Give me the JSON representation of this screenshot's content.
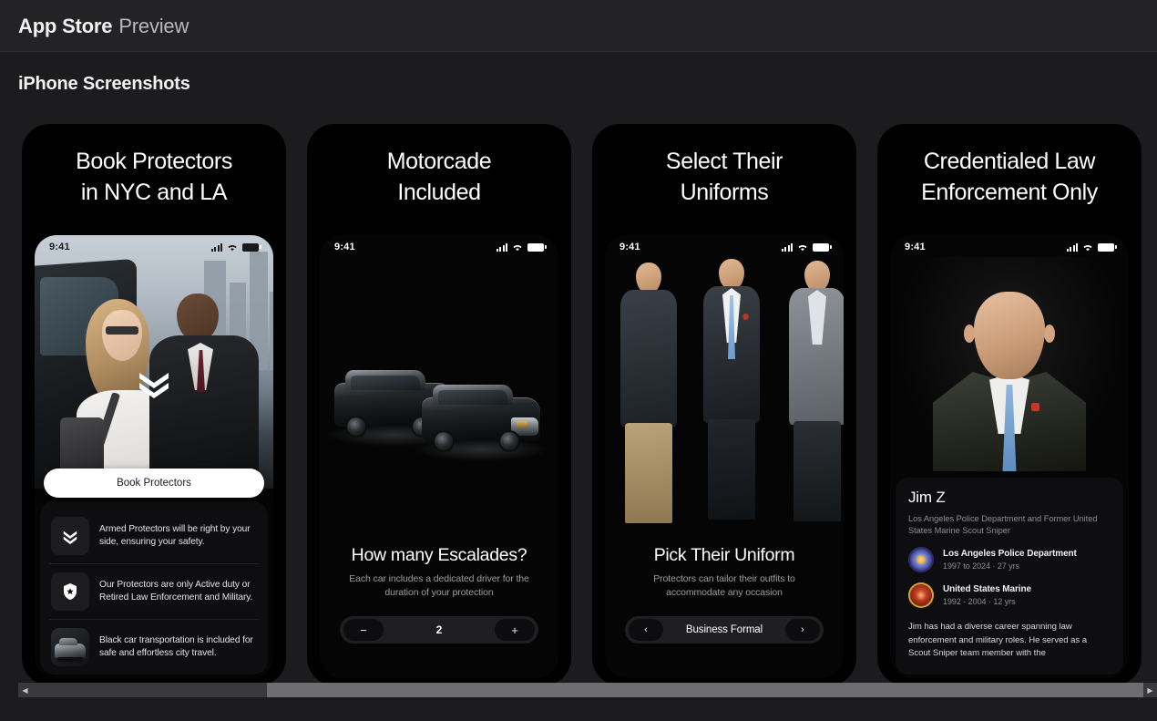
{
  "titlebar": {
    "strong": "App Store",
    "light": "Preview"
  },
  "section": {
    "heading": "iPhone Screenshots"
  },
  "statusbar": {
    "time": "9:41"
  },
  "screens": [
    {
      "headline": "Book Protectors\nin NYC and LA",
      "cta": "Book Protectors",
      "features": [
        {
          "icon": "chevrons-icon",
          "text": "Armed Protectors will be right by your side, ensuring your safety."
        },
        {
          "icon": "badge-shield-icon",
          "text": "Our Protectors are only Active duty or Retired Law Enforcement and Military."
        },
        {
          "icon": "black-car-photo",
          "text": "Black car transportation is included for safe and effortless city travel."
        }
      ]
    },
    {
      "headline": "Motorcade\nIncluded",
      "caption_title": "How many Escalades?",
      "caption_sub": "Each car includes a dedicated driver for the duration of your protection",
      "stepper": {
        "minus": "−",
        "value": "2",
        "plus": "+"
      }
    },
    {
      "headline": "Select Their\nUniforms",
      "caption_title": "Pick Their Uniform",
      "caption_sub": "Protectors can tailor their outfits to accommodate any occasion",
      "picker": {
        "prev": "‹",
        "value": "Business Formal",
        "next": "›"
      }
    },
    {
      "headline": "Credentialed Law\nEnforcement Only",
      "profile": {
        "name": "Jim Z",
        "role": "Los Angeles Police Department and Former United States Marine Scout Sniper",
        "credentials": [
          {
            "badge": "lapd-badge-icon",
            "org": "Los Angeles Police Department",
            "dates": "1997 to 2024 · 27 yrs"
          },
          {
            "badge": "usmc-badge-icon",
            "org": "United States Marine",
            "dates": "1992 - 2004 · 12 yrs"
          }
        ],
        "bio": "Jim has had a diverse career spanning law enforcement and military roles. He served as a Scout Sniper team member with the"
      }
    }
  ],
  "scrollbar": {
    "left_arrow": "◀",
    "right_arrow": "▶"
  },
  "colors": {
    "page_bg": "#1c1c1e",
    "titlebar_bg": "#232325",
    "accent_white": "#ffffff",
    "muted": "#8e8e93"
  }
}
